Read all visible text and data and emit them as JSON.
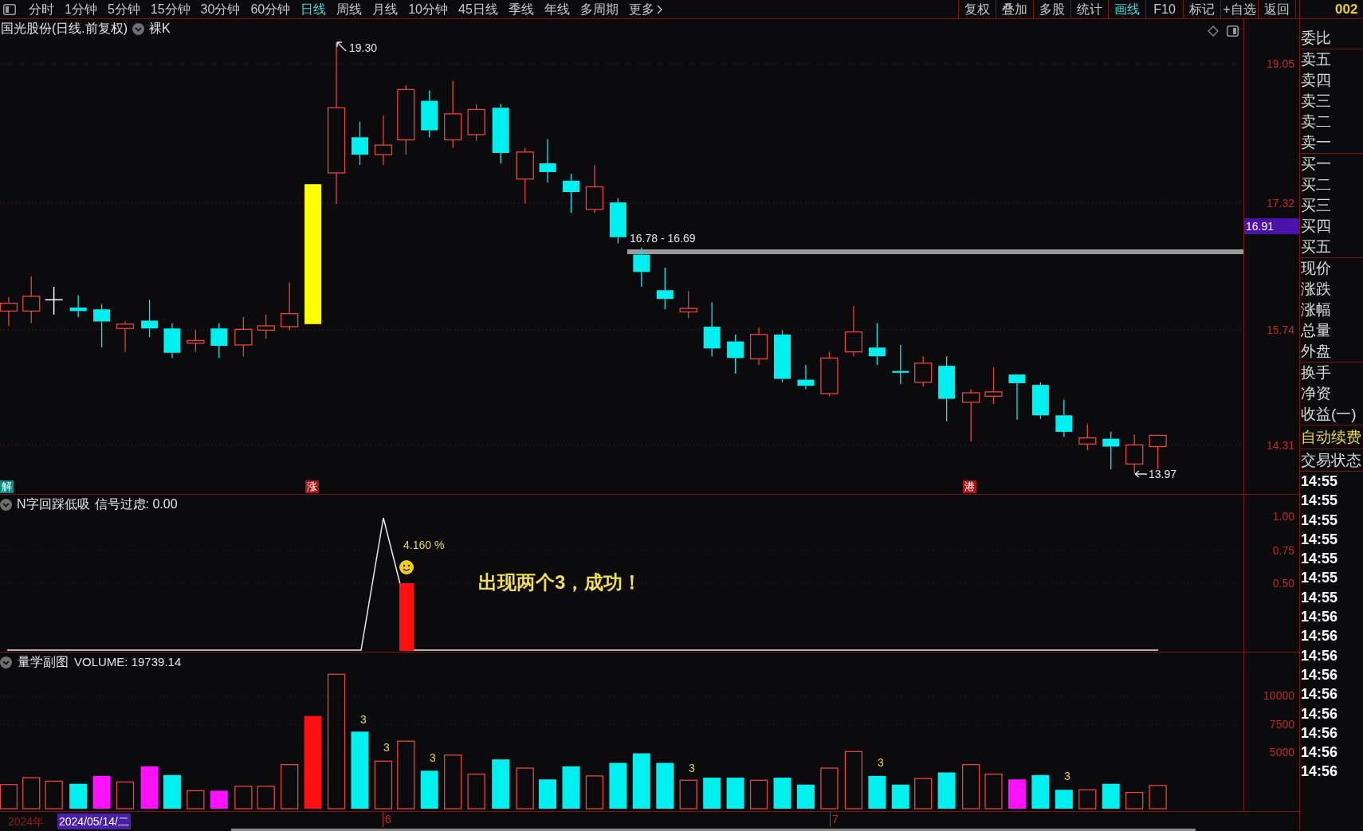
{
  "toolbar": {
    "periods": [
      {
        "label": "分时",
        "selected": false
      },
      {
        "label": "1分钟",
        "selected": false
      },
      {
        "label": "5分钟",
        "selected": false
      },
      {
        "label": "15分钟",
        "selected": false
      },
      {
        "label": "30分钟",
        "selected": false
      },
      {
        "label": "60分钟",
        "selected": false
      },
      {
        "label": "日线",
        "selected": true
      },
      {
        "label": "周线",
        "selected": false
      },
      {
        "label": "月线",
        "selected": false
      },
      {
        "label": "10分钟",
        "selected": false
      },
      {
        "label": "45日线",
        "selected": false
      },
      {
        "label": "季线",
        "selected": false
      },
      {
        "label": "年线",
        "selected": false
      },
      {
        "label": "多周期",
        "selected": false
      }
    ],
    "more": "更多",
    "tools": [
      {
        "label": "复权",
        "selected": false
      },
      {
        "label": "叠加",
        "selected": false
      },
      {
        "label": "多股",
        "selected": false
      },
      {
        "label": "统计",
        "selected": false
      },
      {
        "label": "画线",
        "selected": true
      },
      {
        "label": "F10",
        "selected": false
      },
      {
        "label": "标记",
        "selected": false
      },
      {
        "label": "+自选",
        "selected": false
      },
      {
        "label": "返回",
        "selected": false
      }
    ]
  },
  "stock_code": "002",
  "main_chart": {
    "title": "国光股份(日线.前复权)",
    "mode": "裸K",
    "high_label": "19.30",
    "band_label": "16.78 - 16.69",
    "low_label": "13.97",
    "signal_tags": [
      {
        "label": "解",
        "color": "#138a8a"
      },
      {
        "label": "涨",
        "color": "#a81818"
      },
      {
        "label": "港",
        "color": "#a81818"
      }
    ],
    "price_ticks": [
      "19.05",
      "17.32",
      "15.74",
      "14.31"
    ],
    "current_price": "16.91"
  },
  "indicator_panel": {
    "name": "N字回踩低吸",
    "reading": "信号过虑: 0.00",
    "value_label": "4.160 %",
    "message": "出现两个3，成功！",
    "ticks": [
      "1.00",
      "0.75",
      "0.50"
    ]
  },
  "volume_panel": {
    "name": "量学副图",
    "reading": "VOLUME: 19739.14",
    "bar_labels": [
      "3",
      "3",
      "3",
      "3",
      "3",
      "3"
    ],
    "ticks": [
      "10000",
      "7500",
      "5000"
    ]
  },
  "date_axis": {
    "year": "2024年",
    "cursor_date": "2024/05/14/二",
    "months": [
      "6",
      "7"
    ]
  },
  "quote_panel": {
    "groups": [
      [
        "委比"
      ],
      [
        "卖五",
        "卖四",
        "卖三",
        "卖二",
        "卖一"
      ],
      [
        "买一",
        "买二",
        "买三",
        "买四",
        "买五"
      ],
      [
        "现价",
        "涨跌",
        "涨幅",
        "总量",
        "外盘"
      ],
      [
        "换手",
        "净资",
        "收益(一)"
      ]
    ],
    "promo": "自动续费",
    "status": "交易状态",
    "times": [
      "14:55",
      "14:55",
      "14:55",
      "14:55",
      "14:55",
      "14:55",
      "14:55",
      "14:56",
      "14:56",
      "14:56",
      "14:56",
      "14:56",
      "14:56",
      "14:56",
      "14:56",
      "14:56"
    ]
  }
}
